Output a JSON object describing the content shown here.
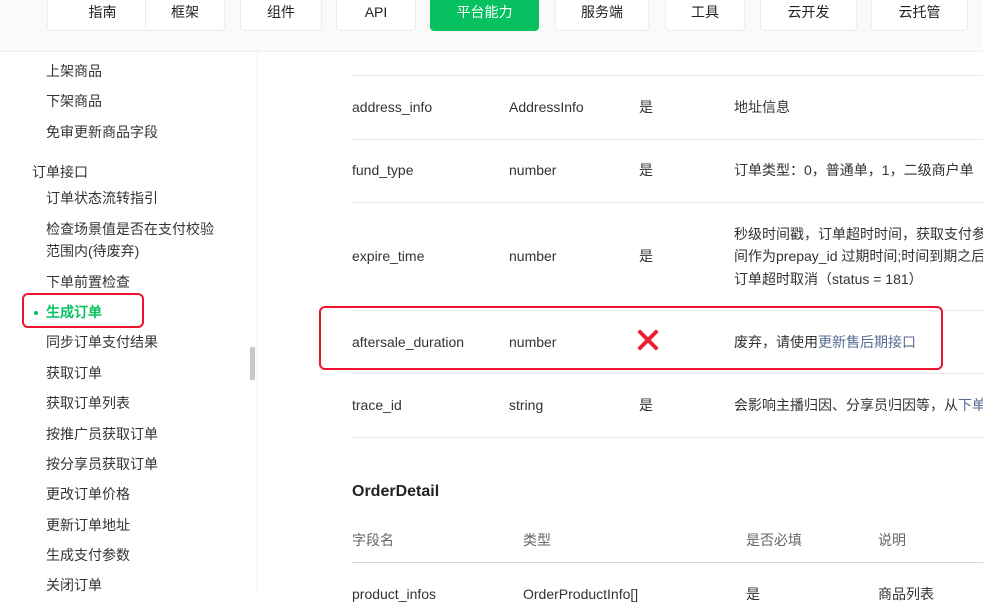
{
  "nav": {
    "tabs": [
      "指南",
      "框架",
      "组件",
      "API",
      "平台能力",
      "服务端",
      "工具",
      "云开发",
      "云托管"
    ],
    "active_index": 4,
    "accent": "#07c160"
  },
  "sidebar": {
    "items_top": [
      "上架商品",
      "下架商品",
      "免审更新商品字段"
    ],
    "group_title": "订单接口",
    "items": [
      "订单状态流转指引",
      "检查场景值是否在支付校验",
      "范围内(待废弃)",
      "下单前置检查",
      "生成订单",
      "同步订单支付结果",
      "获取订单",
      "获取订单列表",
      "按推广员获取订单",
      "按分享员获取订单",
      "更改订单价格",
      "更新订单地址",
      "生成支付参数",
      "关闭订单"
    ],
    "active_item": "生成订单"
  },
  "table": {
    "rows": [
      {
        "field": "address_info",
        "type": "AddressInfo",
        "required": "是",
        "desc": "地址信息"
      },
      {
        "field": "fund_type",
        "type": "number",
        "required": "是",
        "desc": "订单类型：0，普通单，1，二级商户单"
      },
      {
        "field": "expire_time",
        "type": "number",
        "required": "是",
        "desc_lines": [
          "秒级时间戳，订单超时时间，获取支付参",
          "间作为prepay_id 过期时间;时间到期之后",
          "订单超时取消（status = 181）"
        ]
      },
      {
        "field": "aftersale_duration",
        "type": "number",
        "required": "",
        "desc": "废弃，请使用",
        "desc_link": "更新售后期接口"
      },
      {
        "field": "trace_id",
        "type": "string",
        "required": "是",
        "desc": "会影响主播归因、分享员归因等，从",
        "desc_link": "下单"
      }
    ]
  },
  "order_detail": {
    "title": "OrderDetail",
    "headers": [
      "字段名",
      "类型",
      "是否必填",
      "说明"
    ],
    "partial_row": {
      "field": "product_infos",
      "type": "OrderProductInfo[]",
      "required": "是",
      "desc": "商品列表"
    }
  }
}
